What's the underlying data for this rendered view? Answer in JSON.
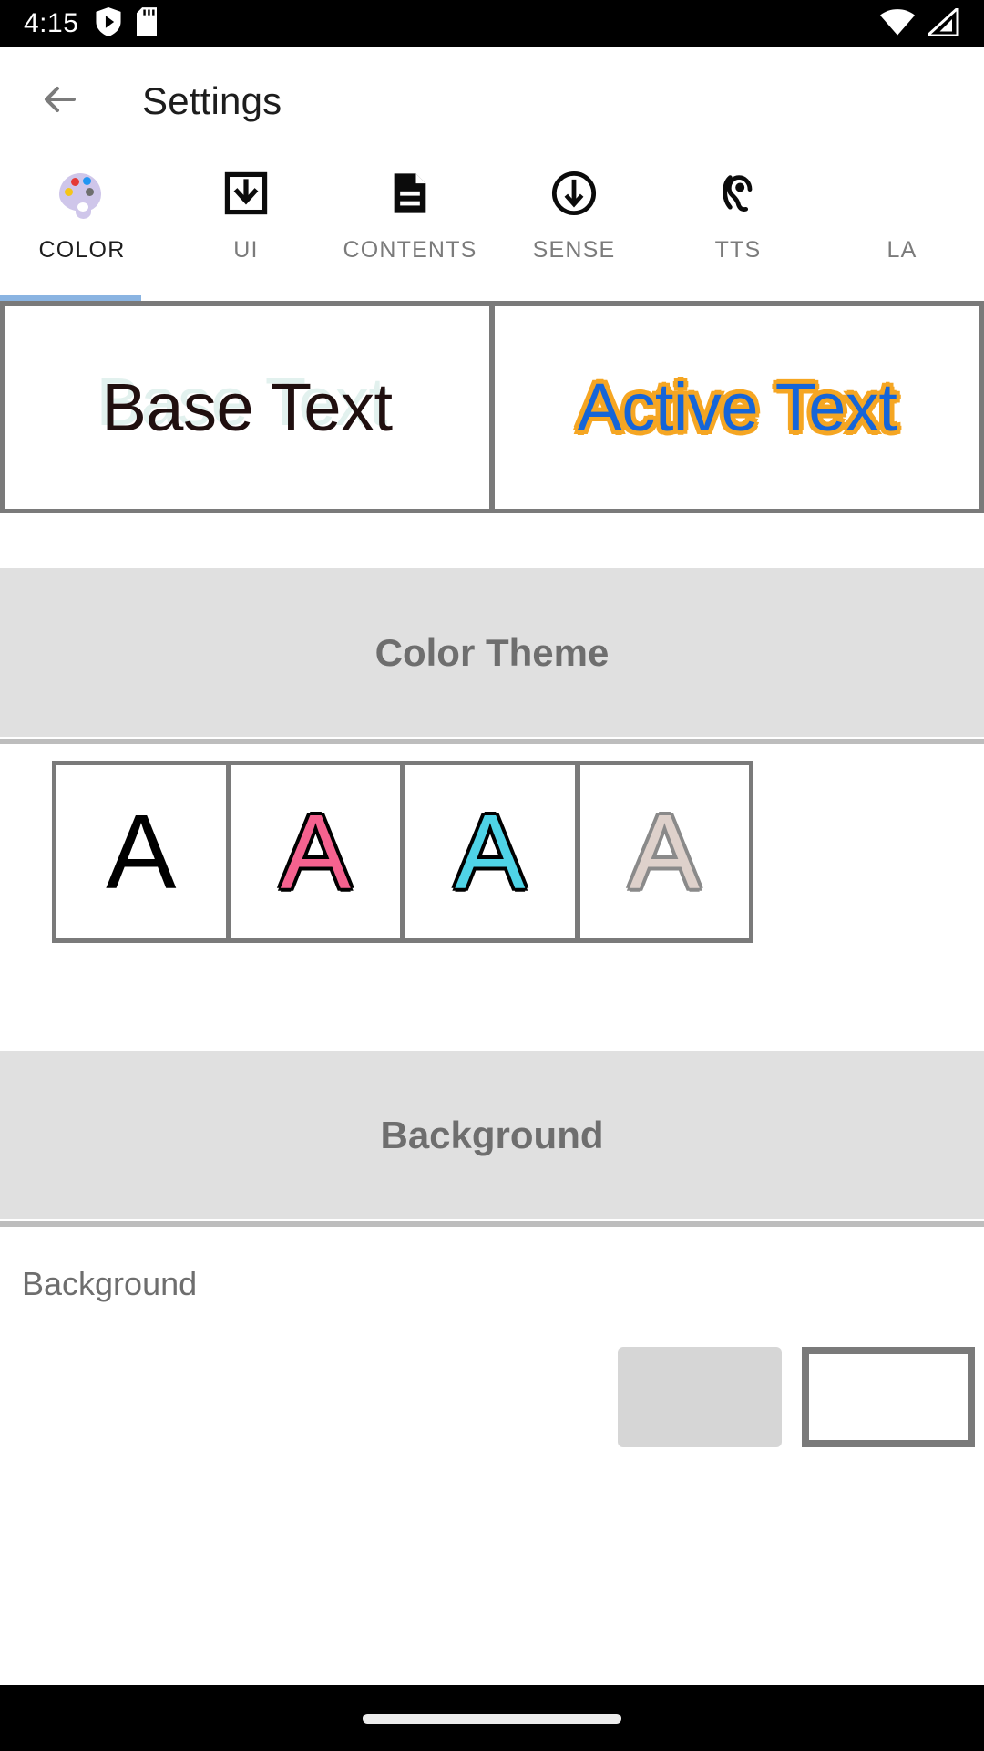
{
  "status_bar": {
    "time": "4:15",
    "left_icons": [
      "play-protect-shield-icon",
      "sd-card-icon"
    ],
    "right_icons": [
      "wifi-icon",
      "cellular-signal-icon"
    ],
    "background_color": "#000000"
  },
  "app_bar": {
    "back_icon": "back-arrow-icon",
    "title": "Settings"
  },
  "tabs": {
    "active_index": 0,
    "indicator_color": "#8ab4e2",
    "items": [
      {
        "label": "COLOR",
        "icon": "palette-icon"
      },
      {
        "label": "UI",
        "icon": "download-box-icon"
      },
      {
        "label": "CONTENTS",
        "icon": "document-icon"
      },
      {
        "label": "SENSE",
        "icon": "arrow-down-circle-icon"
      },
      {
        "label": "TTS",
        "icon": "ear-hearing-icon"
      },
      {
        "label": "LA",
        "icon": "clipped-tab-icon"
      }
    ]
  },
  "preview": {
    "base_text": "Base Text",
    "active_text": "Active Text",
    "base_text_color": "#200f0f",
    "base_shadow_color": "#e2f1ee",
    "active_text_color": "#1565d8",
    "active_outline_color": "#f5a623",
    "frame_color": "#7a7a7a"
  },
  "sections": [
    {
      "title": "Color Theme"
    },
    {
      "title": "Background"
    }
  ],
  "color_theme": {
    "title": "Color Theme",
    "swatches": [
      {
        "letter": "A",
        "name": "theme-black",
        "fill": "#000000",
        "outline": "#000000"
      },
      {
        "letter": "A",
        "name": "theme-pink",
        "fill": "#f5628f",
        "outline": "#000000"
      },
      {
        "letter": "A",
        "name": "theme-cyan",
        "fill": "#4fd3e6",
        "outline": "#000000"
      },
      {
        "letter": "A",
        "name": "theme-beige",
        "fill": "#ded1cb",
        "outline": "#8a8a8a"
      }
    ]
  },
  "background_section": {
    "title": "Background",
    "rows": [
      {
        "label": "Background"
      }
    ],
    "chip_gray_color": "#d6d6d6",
    "chip_white_color": "#ffffff"
  },
  "nav_bar": {
    "gesture_pill": "home-gesture-pill"
  }
}
